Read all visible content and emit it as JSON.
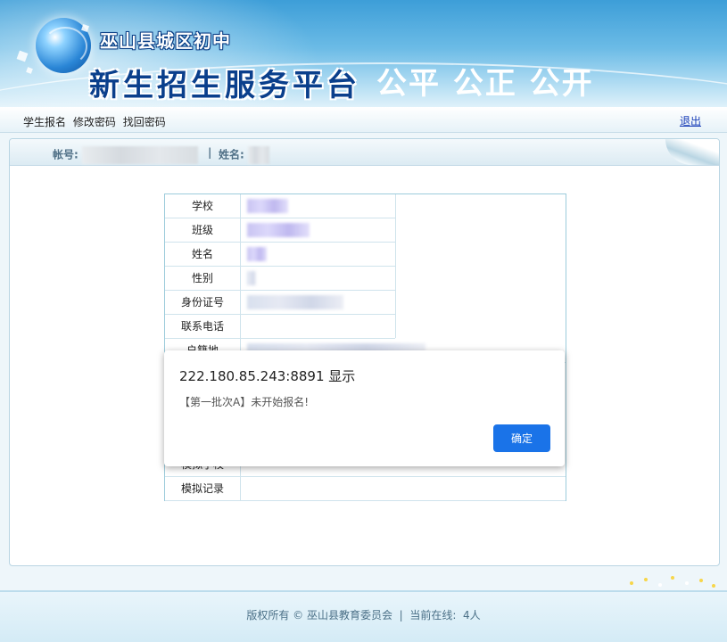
{
  "banner": {
    "school": "巫山县城区初中",
    "platform": "新生招生服务平台",
    "slogan": "公平 公正 公开"
  },
  "topnav": {
    "links": [
      "学生报名",
      "修改密码",
      "找回密码"
    ],
    "logout": "退出"
  },
  "panel": {
    "account_label": "帐号:",
    "separator": "|",
    "name_label": "姓名:"
  },
  "info_table": {
    "rows": [
      {
        "label": "学校"
      },
      {
        "label": "班级"
      },
      {
        "label": "姓名"
      },
      {
        "label": "性别"
      },
      {
        "label": "身份证号"
      },
      {
        "label": "联系电话"
      },
      {
        "label": "户籍地"
      }
    ],
    "bottom_rows": [
      {
        "label": "模拟学校"
      },
      {
        "label": "模拟记录"
      }
    ]
  },
  "dialog": {
    "title": "222.180.85.243:8891 显示",
    "message": "【第一批次A】未开始报名!",
    "ok_label": "确定"
  },
  "footer": {
    "copyright": "版权所有 © 巫山县教育委员会",
    "separator": "|",
    "online_label": "当前在线:",
    "online_count": "4人"
  }
}
